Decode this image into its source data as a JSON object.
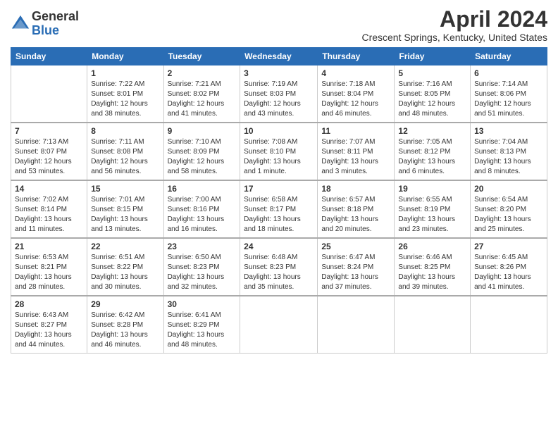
{
  "logo": {
    "general": "General",
    "blue": "Blue"
  },
  "title": "April 2024",
  "location": "Crescent Springs, Kentucky, United States",
  "days_of_week": [
    "Sunday",
    "Monday",
    "Tuesday",
    "Wednesday",
    "Thursday",
    "Friday",
    "Saturday"
  ],
  "weeks": [
    [
      {
        "day": "",
        "info": ""
      },
      {
        "day": "1",
        "info": "Sunrise: 7:22 AM\nSunset: 8:01 PM\nDaylight: 12 hours\nand 38 minutes."
      },
      {
        "day": "2",
        "info": "Sunrise: 7:21 AM\nSunset: 8:02 PM\nDaylight: 12 hours\nand 41 minutes."
      },
      {
        "day": "3",
        "info": "Sunrise: 7:19 AM\nSunset: 8:03 PM\nDaylight: 12 hours\nand 43 minutes."
      },
      {
        "day": "4",
        "info": "Sunrise: 7:18 AM\nSunset: 8:04 PM\nDaylight: 12 hours\nand 46 minutes."
      },
      {
        "day": "5",
        "info": "Sunrise: 7:16 AM\nSunset: 8:05 PM\nDaylight: 12 hours\nand 48 minutes."
      },
      {
        "day": "6",
        "info": "Sunrise: 7:14 AM\nSunset: 8:06 PM\nDaylight: 12 hours\nand 51 minutes."
      }
    ],
    [
      {
        "day": "7",
        "info": "Sunrise: 7:13 AM\nSunset: 8:07 PM\nDaylight: 12 hours\nand 53 minutes."
      },
      {
        "day": "8",
        "info": "Sunrise: 7:11 AM\nSunset: 8:08 PM\nDaylight: 12 hours\nand 56 minutes."
      },
      {
        "day": "9",
        "info": "Sunrise: 7:10 AM\nSunset: 8:09 PM\nDaylight: 12 hours\nand 58 minutes."
      },
      {
        "day": "10",
        "info": "Sunrise: 7:08 AM\nSunset: 8:10 PM\nDaylight: 13 hours\nand 1 minute."
      },
      {
        "day": "11",
        "info": "Sunrise: 7:07 AM\nSunset: 8:11 PM\nDaylight: 13 hours\nand 3 minutes."
      },
      {
        "day": "12",
        "info": "Sunrise: 7:05 AM\nSunset: 8:12 PM\nDaylight: 13 hours\nand 6 minutes."
      },
      {
        "day": "13",
        "info": "Sunrise: 7:04 AM\nSunset: 8:13 PM\nDaylight: 13 hours\nand 8 minutes."
      }
    ],
    [
      {
        "day": "14",
        "info": "Sunrise: 7:02 AM\nSunset: 8:14 PM\nDaylight: 13 hours\nand 11 minutes."
      },
      {
        "day": "15",
        "info": "Sunrise: 7:01 AM\nSunset: 8:15 PM\nDaylight: 13 hours\nand 13 minutes."
      },
      {
        "day": "16",
        "info": "Sunrise: 7:00 AM\nSunset: 8:16 PM\nDaylight: 13 hours\nand 16 minutes."
      },
      {
        "day": "17",
        "info": "Sunrise: 6:58 AM\nSunset: 8:17 PM\nDaylight: 13 hours\nand 18 minutes."
      },
      {
        "day": "18",
        "info": "Sunrise: 6:57 AM\nSunset: 8:18 PM\nDaylight: 13 hours\nand 20 minutes."
      },
      {
        "day": "19",
        "info": "Sunrise: 6:55 AM\nSunset: 8:19 PM\nDaylight: 13 hours\nand 23 minutes."
      },
      {
        "day": "20",
        "info": "Sunrise: 6:54 AM\nSunset: 8:20 PM\nDaylight: 13 hours\nand 25 minutes."
      }
    ],
    [
      {
        "day": "21",
        "info": "Sunrise: 6:53 AM\nSunset: 8:21 PM\nDaylight: 13 hours\nand 28 minutes."
      },
      {
        "day": "22",
        "info": "Sunrise: 6:51 AM\nSunset: 8:22 PM\nDaylight: 13 hours\nand 30 minutes."
      },
      {
        "day": "23",
        "info": "Sunrise: 6:50 AM\nSunset: 8:23 PM\nDaylight: 13 hours\nand 32 minutes."
      },
      {
        "day": "24",
        "info": "Sunrise: 6:48 AM\nSunset: 8:23 PM\nDaylight: 13 hours\nand 35 minutes."
      },
      {
        "day": "25",
        "info": "Sunrise: 6:47 AM\nSunset: 8:24 PM\nDaylight: 13 hours\nand 37 minutes."
      },
      {
        "day": "26",
        "info": "Sunrise: 6:46 AM\nSunset: 8:25 PM\nDaylight: 13 hours\nand 39 minutes."
      },
      {
        "day": "27",
        "info": "Sunrise: 6:45 AM\nSunset: 8:26 PM\nDaylight: 13 hours\nand 41 minutes."
      }
    ],
    [
      {
        "day": "28",
        "info": "Sunrise: 6:43 AM\nSunset: 8:27 PM\nDaylight: 13 hours\nand 44 minutes."
      },
      {
        "day": "29",
        "info": "Sunrise: 6:42 AM\nSunset: 8:28 PM\nDaylight: 13 hours\nand 46 minutes."
      },
      {
        "day": "30",
        "info": "Sunrise: 6:41 AM\nSunset: 8:29 PM\nDaylight: 13 hours\nand 48 minutes."
      },
      {
        "day": "",
        "info": ""
      },
      {
        "day": "",
        "info": ""
      },
      {
        "day": "",
        "info": ""
      },
      {
        "day": "",
        "info": ""
      }
    ]
  ]
}
